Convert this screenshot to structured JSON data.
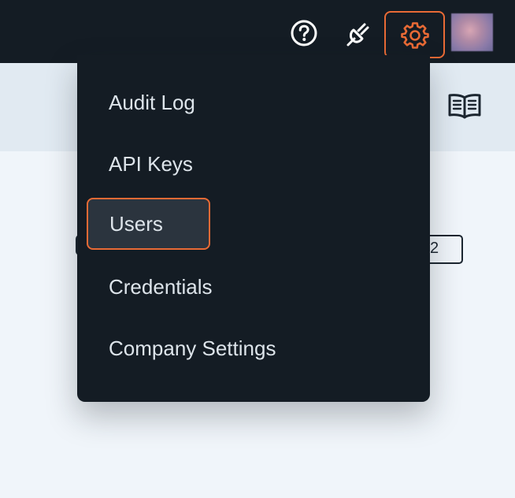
{
  "topbar": {
    "icons": [
      "help-icon",
      "plug-icon",
      "gear-icon",
      "avatar"
    ],
    "accent_color": "#e86a35",
    "background_color": "#141c24"
  },
  "subheader": {
    "icons": [
      "book-icon"
    ]
  },
  "background": {
    "pager_value": "2"
  },
  "menu": {
    "items": [
      {
        "label": "Audit Log"
      },
      {
        "label": "API Keys"
      },
      {
        "label": "Users",
        "selected": true
      },
      {
        "label": "Credentials"
      },
      {
        "label": "Company Settings"
      }
    ]
  }
}
